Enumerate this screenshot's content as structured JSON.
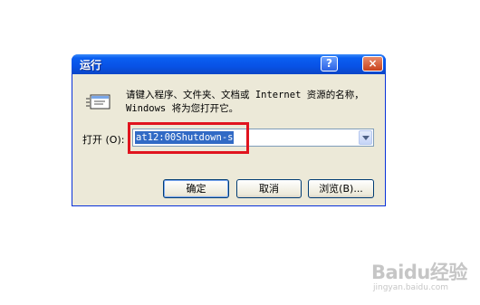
{
  "window": {
    "title": "运行",
    "help_btn": "?",
    "close_btn": "×"
  },
  "dialog": {
    "description": "请键入程序、文件夹、文档或 Internet 资源的名称，Windows 将为您打开它。",
    "open_label": "打开 (O):",
    "command_value": "at12:00Shutdown-s"
  },
  "buttons": {
    "ok": "确定",
    "cancel": "取消",
    "browse": "浏览(B)..."
  },
  "watermark": {
    "brand": "Baidu经验",
    "url": "jingyan.baidu.com"
  },
  "colors": {
    "highlight_box": "#e0141e",
    "title_bar": "#0852e6"
  }
}
